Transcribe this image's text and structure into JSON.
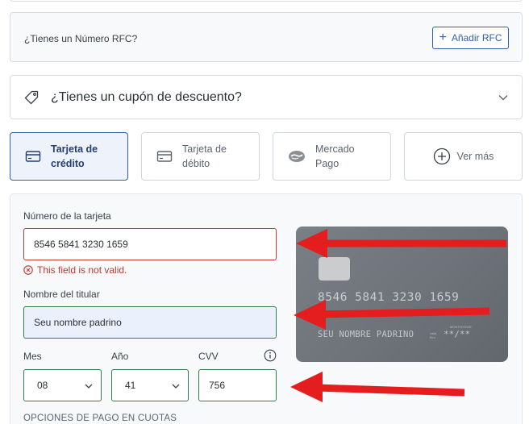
{
  "rfc": {
    "question": "¿Tienes un Número RFC?",
    "button_label": "Añadir RFC"
  },
  "coupon": {
    "question": "¿Tienes un cupón de descuento?"
  },
  "payment_methods": [
    {
      "label_line1": "Tarjeta de",
      "label_line2": "crédito",
      "icon": "credit-card-icon",
      "selected": true
    },
    {
      "label_line1": "Tarjeta de",
      "label_line2": "débito",
      "icon": "debit-card-icon",
      "selected": false
    },
    {
      "label_line1": "Mercado",
      "label_line2": "Pago",
      "icon": "mercado-pago-icon",
      "selected": false
    },
    {
      "label_line1": "Ver más",
      "icon": "plus-circle-icon",
      "selected": false
    }
  ],
  "form": {
    "card_number_label": "Número de la tarjeta",
    "card_number_value": "8546 5841 3230 1659",
    "card_number_error": "This field is not valid.",
    "holder_label": "Nombre del titular",
    "holder_value": "Seu nombre padrino",
    "month_label": "Mes",
    "month_value": "08",
    "year_label": "Año",
    "year_value": "41",
    "cvv_label": "CVV",
    "cvv_value": "756",
    "installments_label": "OPCIONES DE PAGO EN CUOTAS"
  },
  "card_preview": {
    "number": "8546  5841  3230  1659",
    "name": "SEU NOMBRE PADRINO",
    "valid_label": "valid thru",
    "month_year_label": "MONTH/YEAR",
    "expiry": "**/**"
  },
  "colors": {
    "primary": "#2f5fa8",
    "valid_border": "#2e7d4a",
    "error": "#c0392b",
    "annotation_arrow": "#e41e1e"
  }
}
